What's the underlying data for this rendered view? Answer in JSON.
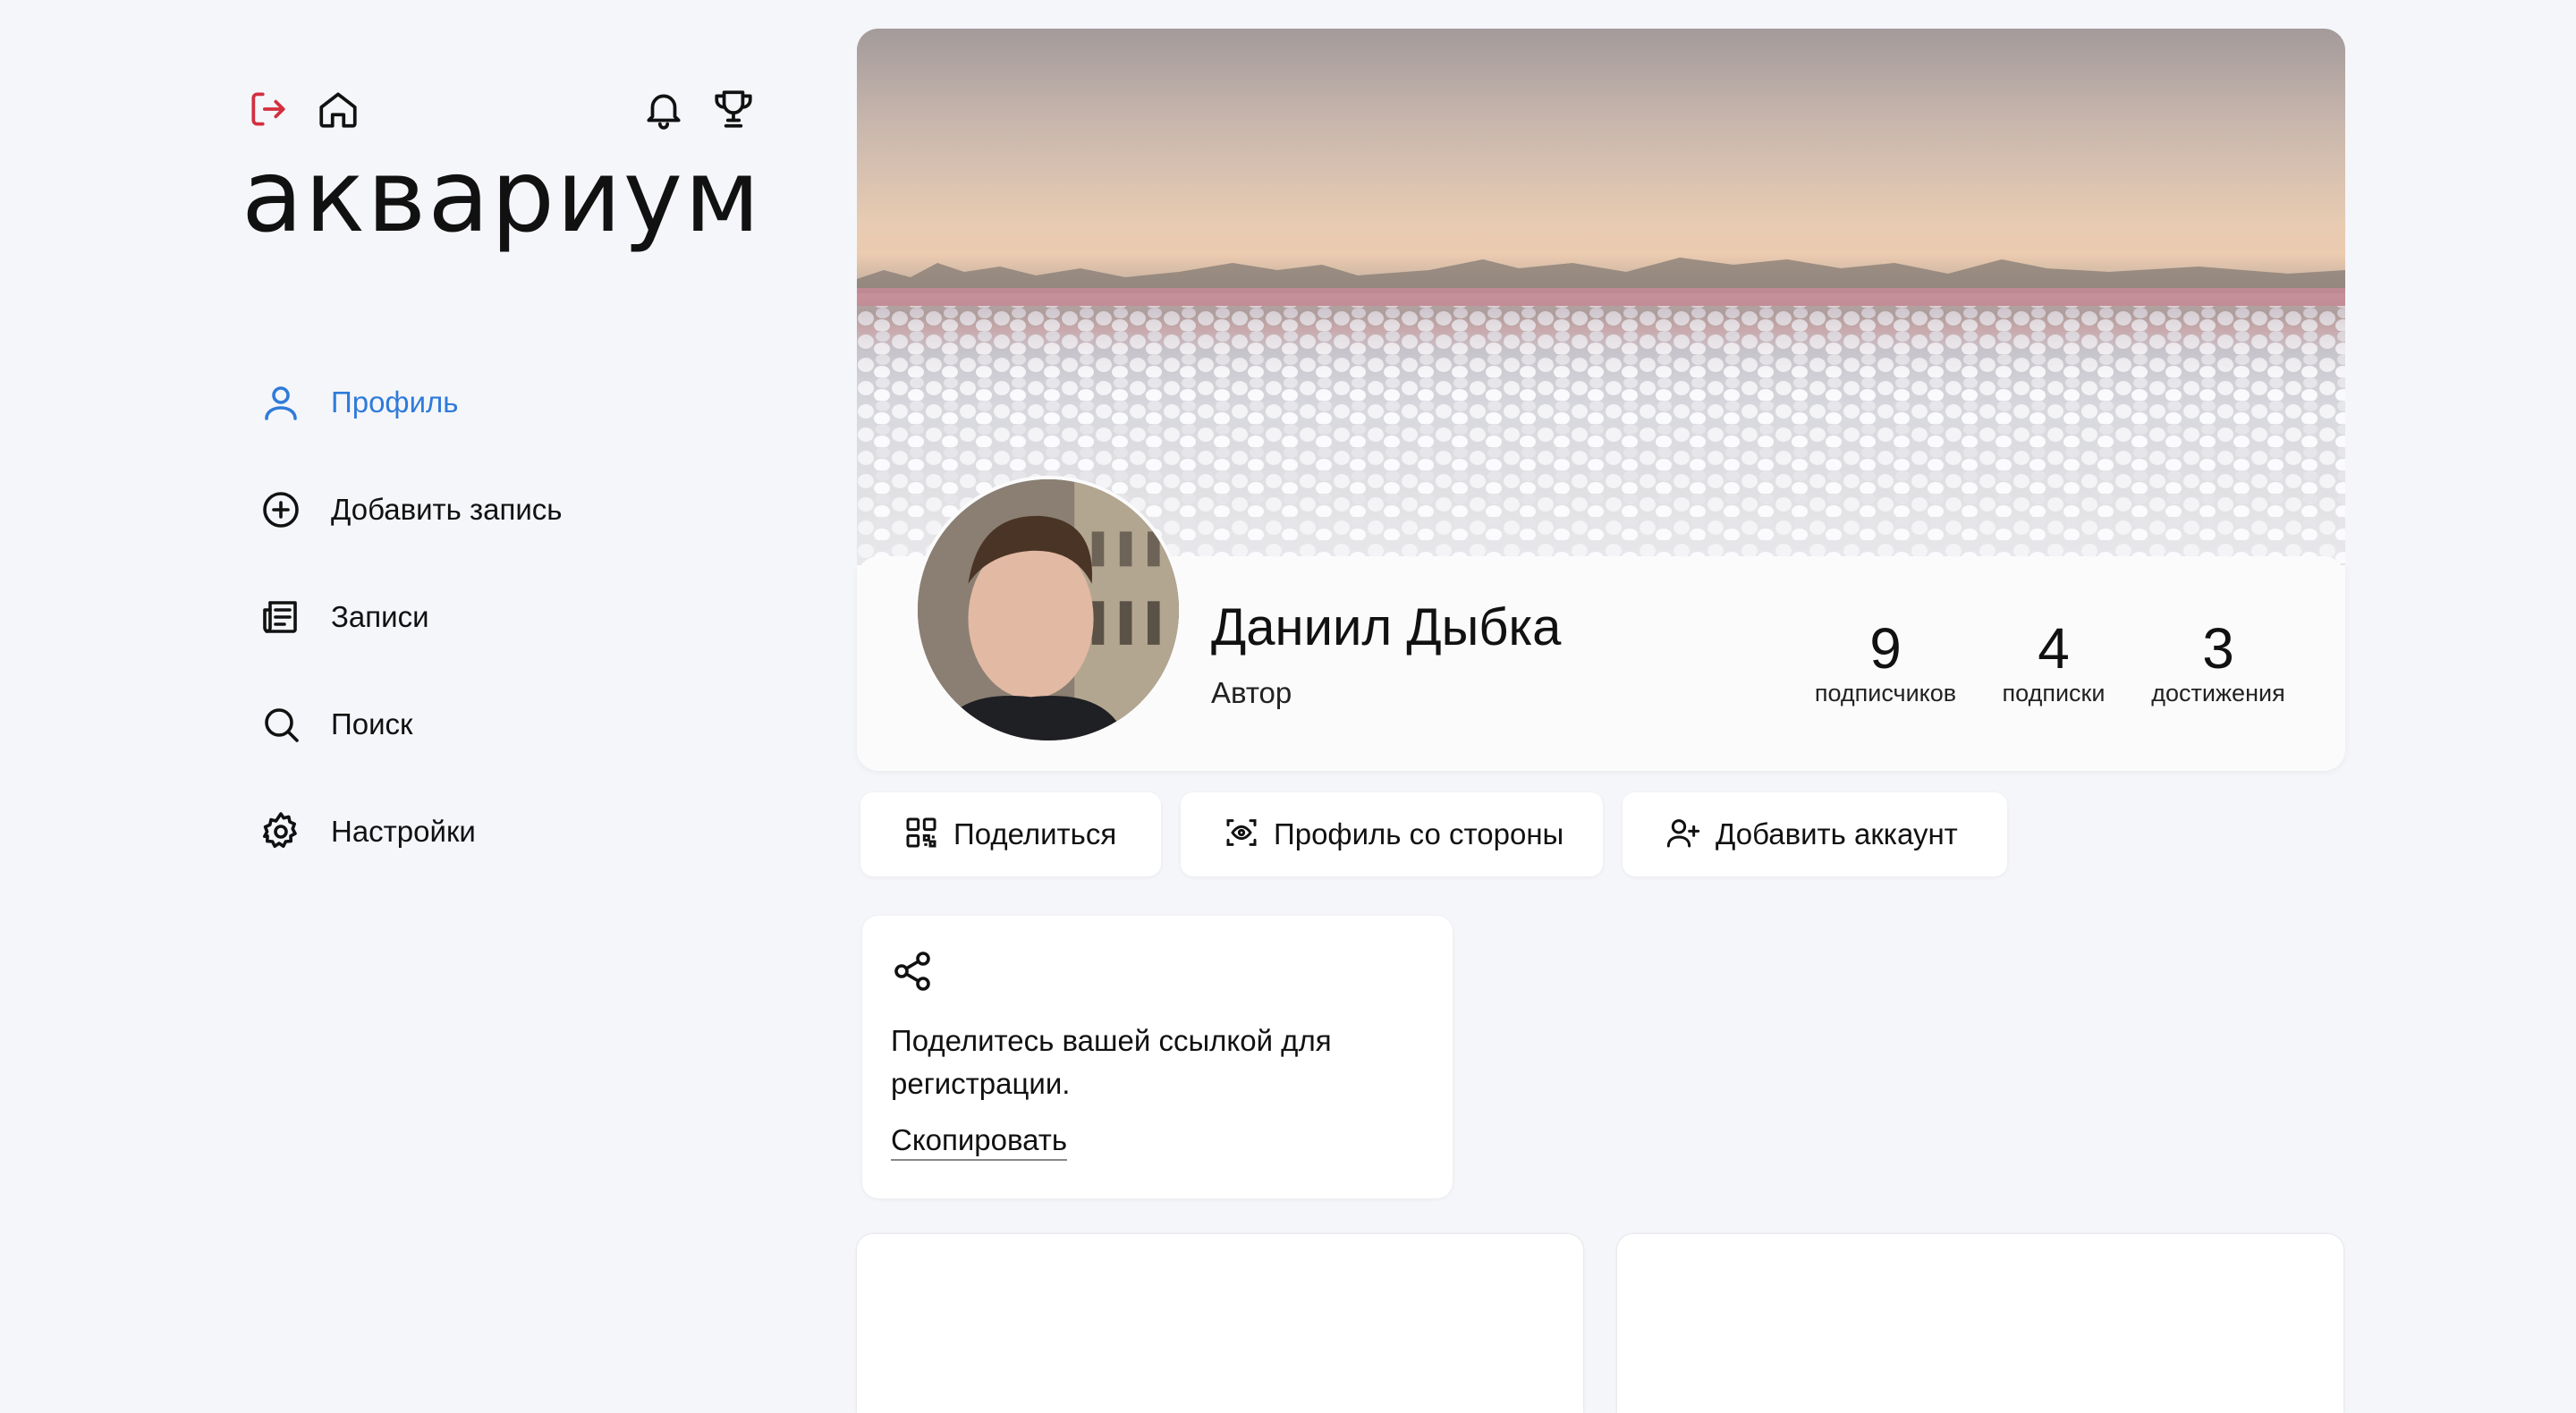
{
  "brand": {
    "logo_text": "аквариум"
  },
  "header_icons": [
    {
      "name": "logout-icon",
      "color": "#d32f3f"
    },
    {
      "name": "home-icon"
    },
    {
      "name": "bell-icon"
    },
    {
      "name": "trophy-icon"
    }
  ],
  "sidebar": {
    "items": [
      {
        "label": "Профиль",
        "icon": "user-icon",
        "active": true
      },
      {
        "label": "Добавить запись",
        "icon": "plus-circle-icon",
        "active": false
      },
      {
        "label": "Записи",
        "icon": "newspaper-icon",
        "active": false
      },
      {
        "label": "Поиск",
        "icon": "search-icon",
        "active": false
      },
      {
        "label": "Настройки",
        "icon": "gear-icon",
        "active": false
      }
    ],
    "active_color": "#2f7bd9"
  },
  "profile": {
    "name": "Даниил Дыбка",
    "role": "Автор",
    "stats": [
      {
        "value": "9",
        "label": "подписчиков"
      },
      {
        "value": "4",
        "label": "подписки"
      },
      {
        "value": "3",
        "label": "достижения"
      }
    ]
  },
  "actions": [
    {
      "label": "Поделиться",
      "icon": "qr-code-icon"
    },
    {
      "label": "Профиль со стороны",
      "icon": "eye-scan-icon"
    },
    {
      "label": "Добавить аккаунт",
      "icon": "user-plus-icon"
    }
  ],
  "share_card": {
    "icon": "share-icon",
    "text": "Поделитесь вашей ссылкой для регистрации.",
    "copy_label": "Скопировать"
  }
}
